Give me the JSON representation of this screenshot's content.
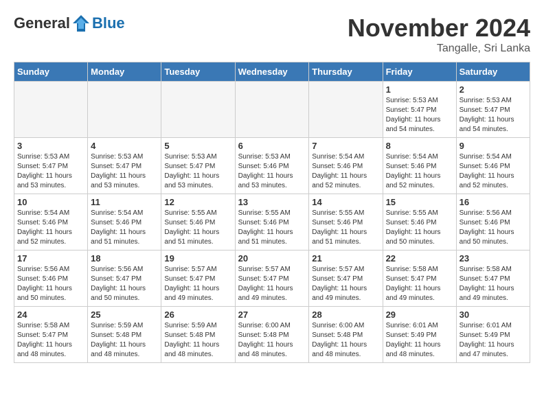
{
  "header": {
    "logo_general": "General",
    "logo_blue": "Blue",
    "month_title": "November 2024",
    "location": "Tangalle, Sri Lanka"
  },
  "days_of_week": [
    "Sunday",
    "Monday",
    "Tuesday",
    "Wednesday",
    "Thursday",
    "Friday",
    "Saturday"
  ],
  "weeks": [
    [
      {
        "day": "",
        "empty": true
      },
      {
        "day": "",
        "empty": true
      },
      {
        "day": "",
        "empty": true
      },
      {
        "day": "",
        "empty": true
      },
      {
        "day": "",
        "empty": true
      },
      {
        "day": "1",
        "sunrise": "5:53 AM",
        "sunset": "5:47 PM",
        "daylight": "11 hours and 54 minutes."
      },
      {
        "day": "2",
        "sunrise": "5:53 AM",
        "sunset": "5:47 PM",
        "daylight": "11 hours and 54 minutes."
      }
    ],
    [
      {
        "day": "3",
        "sunrise": "5:53 AM",
        "sunset": "5:47 PM",
        "daylight": "11 hours and 53 minutes."
      },
      {
        "day": "4",
        "sunrise": "5:53 AM",
        "sunset": "5:47 PM",
        "daylight": "11 hours and 53 minutes."
      },
      {
        "day": "5",
        "sunrise": "5:53 AM",
        "sunset": "5:47 PM",
        "daylight": "11 hours and 53 minutes."
      },
      {
        "day": "6",
        "sunrise": "5:53 AM",
        "sunset": "5:46 PM",
        "daylight": "11 hours and 53 minutes."
      },
      {
        "day": "7",
        "sunrise": "5:54 AM",
        "sunset": "5:46 PM",
        "daylight": "11 hours and 52 minutes."
      },
      {
        "day": "8",
        "sunrise": "5:54 AM",
        "sunset": "5:46 PM",
        "daylight": "11 hours and 52 minutes."
      },
      {
        "day": "9",
        "sunrise": "5:54 AM",
        "sunset": "5:46 PM",
        "daylight": "11 hours and 52 minutes."
      }
    ],
    [
      {
        "day": "10",
        "sunrise": "5:54 AM",
        "sunset": "5:46 PM",
        "daylight": "11 hours and 52 minutes."
      },
      {
        "day": "11",
        "sunrise": "5:54 AM",
        "sunset": "5:46 PM",
        "daylight": "11 hours and 51 minutes."
      },
      {
        "day": "12",
        "sunrise": "5:55 AM",
        "sunset": "5:46 PM",
        "daylight": "11 hours and 51 minutes."
      },
      {
        "day": "13",
        "sunrise": "5:55 AM",
        "sunset": "5:46 PM",
        "daylight": "11 hours and 51 minutes."
      },
      {
        "day": "14",
        "sunrise": "5:55 AM",
        "sunset": "5:46 PM",
        "daylight": "11 hours and 51 minutes."
      },
      {
        "day": "15",
        "sunrise": "5:55 AM",
        "sunset": "5:46 PM",
        "daylight": "11 hours and 50 minutes."
      },
      {
        "day": "16",
        "sunrise": "5:56 AM",
        "sunset": "5:46 PM",
        "daylight": "11 hours and 50 minutes."
      }
    ],
    [
      {
        "day": "17",
        "sunrise": "5:56 AM",
        "sunset": "5:46 PM",
        "daylight": "11 hours and 50 minutes."
      },
      {
        "day": "18",
        "sunrise": "5:56 AM",
        "sunset": "5:47 PM",
        "daylight": "11 hours and 50 minutes."
      },
      {
        "day": "19",
        "sunrise": "5:57 AM",
        "sunset": "5:47 PM",
        "daylight": "11 hours and 49 minutes."
      },
      {
        "day": "20",
        "sunrise": "5:57 AM",
        "sunset": "5:47 PM",
        "daylight": "11 hours and 49 minutes."
      },
      {
        "day": "21",
        "sunrise": "5:57 AM",
        "sunset": "5:47 PM",
        "daylight": "11 hours and 49 minutes."
      },
      {
        "day": "22",
        "sunrise": "5:58 AM",
        "sunset": "5:47 PM",
        "daylight": "11 hours and 49 minutes."
      },
      {
        "day": "23",
        "sunrise": "5:58 AM",
        "sunset": "5:47 PM",
        "daylight": "11 hours and 49 minutes."
      }
    ],
    [
      {
        "day": "24",
        "sunrise": "5:58 AM",
        "sunset": "5:47 PM",
        "daylight": "11 hours and 48 minutes."
      },
      {
        "day": "25",
        "sunrise": "5:59 AM",
        "sunset": "5:48 PM",
        "daylight": "11 hours and 48 minutes."
      },
      {
        "day": "26",
        "sunrise": "5:59 AM",
        "sunset": "5:48 PM",
        "daylight": "11 hours and 48 minutes."
      },
      {
        "day": "27",
        "sunrise": "6:00 AM",
        "sunset": "5:48 PM",
        "daylight": "11 hours and 48 minutes."
      },
      {
        "day": "28",
        "sunrise": "6:00 AM",
        "sunset": "5:48 PM",
        "daylight": "11 hours and 48 minutes."
      },
      {
        "day": "29",
        "sunrise": "6:01 AM",
        "sunset": "5:49 PM",
        "daylight": "11 hours and 48 minutes."
      },
      {
        "day": "30",
        "sunrise": "6:01 AM",
        "sunset": "5:49 PM",
        "daylight": "11 hours and 47 minutes."
      }
    ]
  ]
}
